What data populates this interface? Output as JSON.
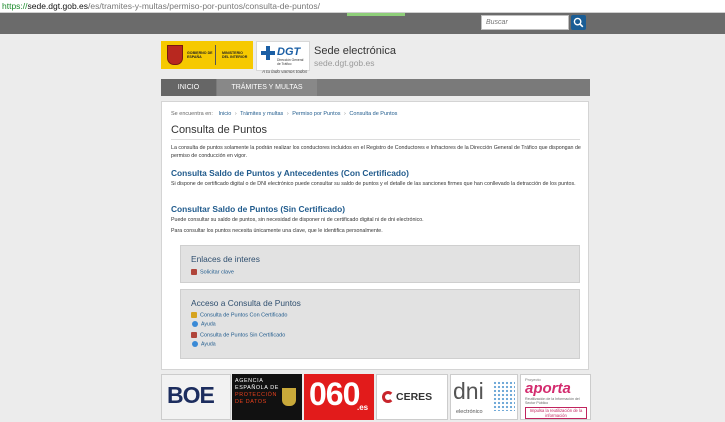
{
  "browser": {
    "url_scheme": "https://",
    "url_host": "sede.dgt.gob.es",
    "url_path": "/es/tramites-y-multas/permiso-por-puntos/consulta-de-puntos/"
  },
  "search": {
    "placeholder": "Buscar",
    "icon": "search-icon"
  },
  "header": {
    "gov_logo_text": "GOBIERNO DE ESPAÑA",
    "gov_logo_ministry": "MINISTERIO DEL INTERIOR",
    "dgt_logo_text": "DGT",
    "dgt_logo_sub": "Dirección General de Tráfico",
    "tagline": "A tu lado vamos todos",
    "title": "Sede electrónica",
    "subtitle": "sede.dgt.gob.es"
  },
  "nav": {
    "items": [
      {
        "label": "INICIO"
      },
      {
        "label": "TRÁMITES Y MULTAS"
      }
    ]
  },
  "breadcrumb": {
    "prefix": "Se encuentra en:",
    "items": [
      {
        "label": "Inicio"
      },
      {
        "label": "Trámites y multas"
      },
      {
        "label": "Permiso por Puntos"
      },
      {
        "label": "Consulta de Puntos"
      }
    ],
    "separator": "›"
  },
  "page": {
    "title": "Consulta de Puntos",
    "intro": "La consulta de puntos solamente la podrán realizar los conductores incluidos en el Registro de Conductores e Infractores de la Dirección General de Tráfico que dispongan de permiso de conducción en vigor.",
    "section1": {
      "title": "Consulta Saldo de Puntos y Antecedentes (Con Certificado)",
      "text": "Si dispone de certificado digital o de DNI electrónico puede consultar su saldo de puntos y el detalle de las sanciones firmes que han conllevado la detracción de los puntos."
    },
    "section2": {
      "title": "Consultar Saldo de Puntos (Sin Certificado)",
      "text1": "Puede consultar su saldo de puntos, sin necesidad de disponer ni de certificado digital ni de dni electrónico.",
      "text2": "Para consultar los puntos necesita únicamente una clave, que le identifica personalmente."
    }
  },
  "panels": {
    "enlaces": {
      "title": "Enlaces de interes",
      "link": "Solicitar clave"
    },
    "acceso": {
      "title": "Acceso a Consulta de Puntos",
      "link1": "Consulta de Puntos Con Certificado",
      "help1": "Ayuda",
      "link2": "Consulta de Puntos Sin Certificado",
      "help2": "Ayuda"
    }
  },
  "footer": {
    "boe": "BOE",
    "agencia": [
      "AGENCIA",
      "ESPAÑOLA DE",
      "PROTECCIÓN",
      "DE DATOS"
    ],
    "n060": "060",
    "n060_suffix": ".es",
    "ceres": "CERES",
    "dni": "dni",
    "dni_sub": "electrónico",
    "aporta_pre": "Proyecto",
    "aporta": "aporta",
    "aporta_sub": "Reutilización de la Información del Sector Público",
    "aporta_tag": "Impulsa la reutilización de la información"
  },
  "colors": {
    "link": "#1f5a8c",
    "topbar": "#6b6b6b",
    "nav": "#7a7a7a",
    "panel": "#e2e2e2"
  }
}
